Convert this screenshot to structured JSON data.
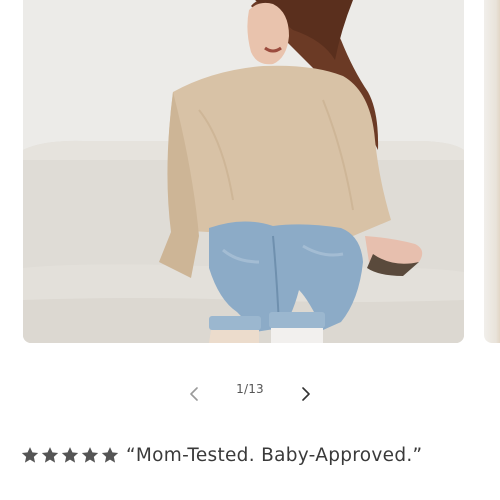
{
  "gallery": {
    "current_slide": 1,
    "total_slides": 13,
    "counter_text": "1/13",
    "prev_icon": "chevron-left-icon",
    "next_icon": "chevron-right-icon"
  },
  "review": {
    "rating": 5,
    "rating_max": 5,
    "star_icon": "star-icon",
    "star_color": "#555555",
    "quote": "“Mom-Tested. Baby-Approved.”"
  },
  "colors": {
    "text": "#3a3a3a",
    "muted": "#555555",
    "background": "#ffffff"
  }
}
